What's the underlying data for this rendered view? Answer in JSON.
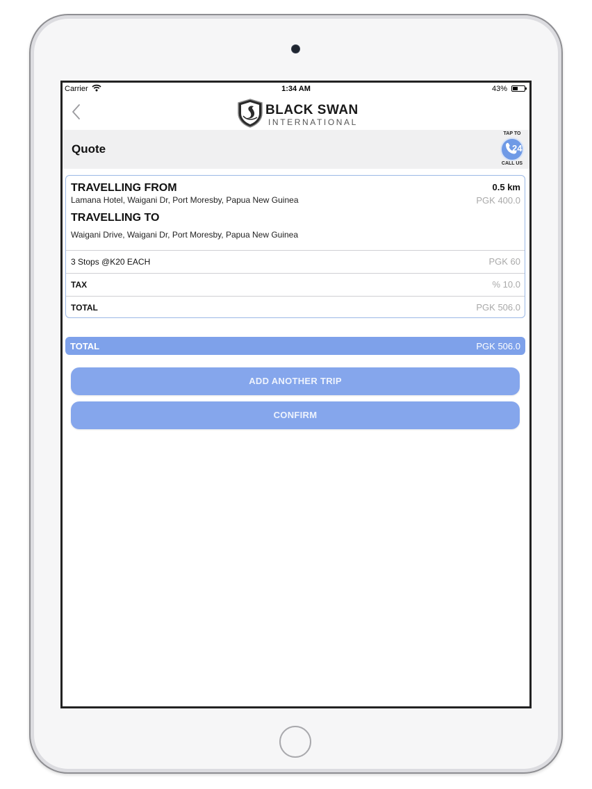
{
  "status_bar": {
    "carrier": "Carrier",
    "time": "1:34 AM",
    "battery": "43%",
    "battery_level": 0.43
  },
  "brand": {
    "name": "BLACK SWAN",
    "subtitle": "INTERNATIONAL"
  },
  "header": {
    "title": "Quote",
    "call_badge": {
      "top": "TAP TO",
      "number": "24",
      "bottom": "CALL US"
    }
  },
  "quote": {
    "from_label": "TRAVELLING FROM",
    "from_address": "Lamana Hotel, Waigani Dr, Port Moresby, Papua New Guinea",
    "distance": "0.5 km",
    "fare": "PGK 400.0",
    "to_label": "TRAVELLING TO",
    "to_address": "Waigani Drive, Waigani Dr, Port Moresby, Papua New Guinea",
    "rows": [
      {
        "label": "3 Stops @K20 EACH",
        "value": "PGK 60"
      },
      {
        "label": "TAX",
        "value": "% 10.0"
      },
      {
        "label": "TOTAL",
        "value": "PGK 506.0"
      }
    ]
  },
  "total_bar": {
    "label": "TOTAL",
    "value": "PGK 506.0"
  },
  "buttons": {
    "add_trip": "ADD ANOTHER TRIP",
    "confirm": "CONFIRM"
  },
  "colors": {
    "accent": "#7ea1ea",
    "button": "#85a6ec",
    "muted_text": "#a9a9a9"
  }
}
